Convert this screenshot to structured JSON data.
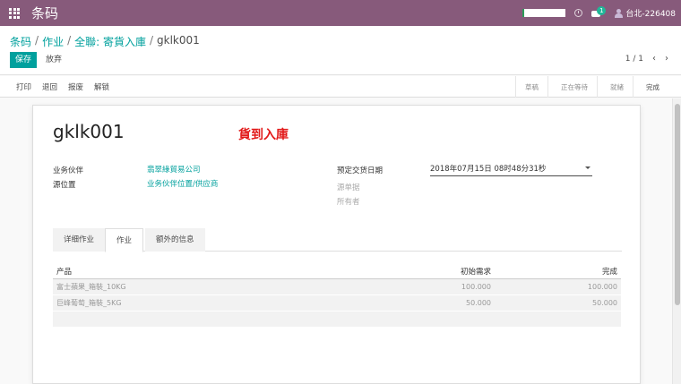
{
  "topbar": {
    "brand": "条码",
    "notification_count": "1",
    "user_name": "台北-226408",
    "accent": "#875a7b"
  },
  "breadcrumb": {
    "items": [
      "条码",
      "作业",
      "全聯: 寄貨入庫",
      "gklk001"
    ]
  },
  "buttons": {
    "save": "保存",
    "discard": "放弃"
  },
  "pager": {
    "value": "1 / 1",
    "prev_icon": "chevron-left-icon",
    "next_icon": "chevron-right-icon"
  },
  "actions": [
    "打印",
    "退回",
    "报废",
    "解锁"
  ],
  "stages": [
    "草稿",
    "正在等待",
    "就緒",
    "完成"
  ],
  "record": {
    "name": "gklk001",
    "status_text": "貨到入庫",
    "status_color": "#e21a1a"
  },
  "fields": {
    "partner_label": "业务伙伴",
    "partner_value": "翡翠綠貿易公司",
    "source_location_label": "源位置",
    "source_location_value": "业务伙伴位置/供应商",
    "scheduled_date_label": "预定交货日期",
    "scheduled_date_value": "2018年07月15日 08时48分31秒",
    "source_doc_label": "源单据",
    "owner_label": "所有者"
  },
  "tabs": [
    "详细作业",
    "作业",
    "额外的信息"
  ],
  "table": {
    "headers": [
      "产品",
      "初始需求",
      "完成"
    ],
    "rows": [
      {
        "product": "富士蘋果_箱裝_10KG",
        "initial": "100.000",
        "done": "100.000"
      },
      {
        "product": "巨峰葡萄_箱裝_5KG",
        "initial": "50.000",
        "done": "50.000"
      }
    ]
  }
}
